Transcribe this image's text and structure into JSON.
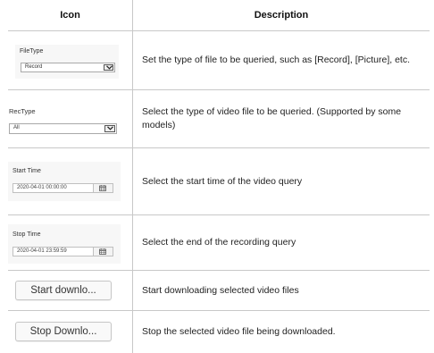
{
  "table": {
    "header": {
      "icon": "Icon",
      "description": "Description"
    },
    "rows": [
      {
        "panel": {
          "label": "FileType",
          "value": "Record",
          "control": "dropdown"
        },
        "description": "Set the type of file to be queried, such as [Record], [Picture], etc."
      },
      {
        "panel": {
          "label": "RecType",
          "value": "All",
          "control": "dropdown"
        },
        "description": "Select the type of video file to be queried. (Supported by some models)"
      },
      {
        "panel": {
          "label": "Start Time",
          "value": "2020-04-01 00:00:00",
          "control": "datetime",
          "icon": "calendar-icon"
        },
        "description": "Select the start time of the video query"
      },
      {
        "panel": {
          "label": "Stop Time",
          "value": "2020-04-01 23:59:59",
          "control": "datetime",
          "icon": "calendar-icon"
        },
        "description": "Select the end of the recording query"
      },
      {
        "button": {
          "label": "Start downlo..."
        },
        "description": "Start downloading selected video files"
      },
      {
        "button": {
          "label": "Stop Downlo..."
        },
        "description": "Stop the selected video file being downloaded."
      }
    ]
  }
}
